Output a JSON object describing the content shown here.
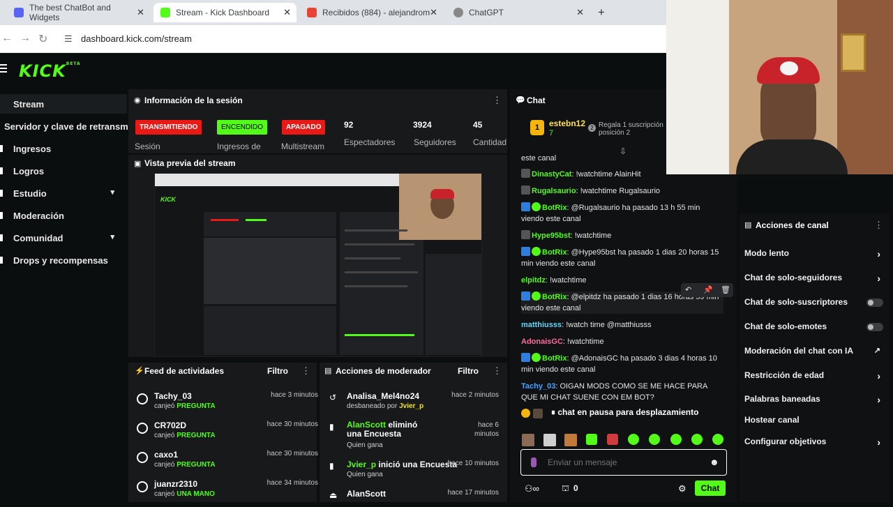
{
  "browser": {
    "tabs": [
      {
        "title": "The best ChatBot and Widgets",
        "color": "#5865f2"
      },
      {
        "title": "Stream - Kick Dashboard",
        "color": "#53fc18"
      },
      {
        "title": "Recibidos (884) - alejandromer",
        "color": "#ea4335"
      },
      {
        "title": "ChatGPT",
        "color": "#888888"
      }
    ],
    "new_tab": "+",
    "close": "✕",
    "url": "dashboard.kick.com/stream"
  },
  "app": {
    "logo": "KICK",
    "logo_tag": "BETA",
    "accent": "#53fc18"
  },
  "sidebar": {
    "items": [
      {
        "label": "Stream",
        "icon": "video-icon"
      },
      {
        "label": "Servidor y clave de retransm",
        "icon": ""
      },
      {
        "label": "Ingresos",
        "icon": "money-icon"
      },
      {
        "label": "Logros",
        "icon": "trophy-icon"
      },
      {
        "label": "Estudio",
        "icon": "studio-icon",
        "chevron": "▾"
      },
      {
        "label": "Moderación",
        "icon": "shield-icon"
      },
      {
        "label": "Comunidad",
        "icon": "people-icon",
        "chevron": "▾"
      },
      {
        "label": "Drops y recompensas",
        "icon": "gift-icon"
      }
    ]
  },
  "session": {
    "title": "Información de la sesión",
    "menu": "⋮",
    "badges": [
      {
        "label": "TRANSMITIENDO",
        "bg": "#e91916",
        "fg": "#ffffff"
      },
      {
        "label": "ENCENDIDO",
        "bg": "#53fc18",
        "fg": "#000000"
      },
      {
        "label": "APAGADO",
        "bg": "#e91916",
        "fg": "#ffffff"
      }
    ],
    "stats": [
      {
        "value": "92",
        "label": "Espectadores"
      },
      {
        "value": "3924",
        "label": "Seguidores"
      },
      {
        "value": "45",
        "label": "Cantidad"
      }
    ],
    "badge_labels": [
      "Sesión",
      "Ingresos de",
      "Multistream"
    ]
  },
  "preview": {
    "title": "Vista previa del stream"
  },
  "feed": {
    "title": "Feed de actividades",
    "filter": "Filtro",
    "menu": "⋮",
    "rows": [
      {
        "name": "Tachy_03",
        "action": "canjeó",
        "item": "PREGUNTA",
        "time": "hace 3 minutos"
      },
      {
        "name": "CR702D",
        "action": "canjeó",
        "item": "PREGUNTA",
        "time": "hace 30 minutos"
      },
      {
        "name": "caxo1",
        "action": "canjeó",
        "item": "PREGUNTA",
        "time": "hace 30 minutos"
      },
      {
        "name": "juanzr2310",
        "action": "canjeó",
        "item": "UNA MANO",
        "time": "hace 34 minutos"
      }
    ]
  },
  "modactions": {
    "title": "Acciones de moderador",
    "filter": "Filtro",
    "menu": "⋮",
    "rows": [
      {
        "user": "Analisa_Mel4no24",
        "text": "",
        "sub_a": "desbaneado por",
        "sub_b": "Jvier_p",
        "time": "hace 2 minutos",
        "icon": "↺"
      },
      {
        "user": "AlanScott",
        "text": " eliminó una Encuesta",
        "sub_a": "Quien gana",
        "sub_b": "",
        "time": "hace 6 minutos",
        "icon": "▮"
      },
      {
        "user": "Jvier_p",
        "text": " inició una Encuesta",
        "sub_a": "Quien gana",
        "sub_b": "",
        "time": "hace 10 minutos",
        "icon": "▮"
      },
      {
        "user": "AlanScott",
        "text": "",
        "sub_a": "",
        "sub_b": "",
        "time": "hace 17 minutos",
        "icon": "⏏"
      }
    ]
  },
  "chat": {
    "title": "Chat",
    "pinned_user": "estebn12",
    "pinned_meta": "7",
    "pinned_text_1": "Regala 1 suscripción",
    "pinned_text_2": "posición 2",
    "pinned_rank": "1",
    "pinned_rank2": "2",
    "messages": [
      {
        "user": "",
        "color": "#ffffff",
        "text": "este canal",
        "bot": false
      },
      {
        "user": "DinastyCat",
        "color": "#53fc18",
        "text": ": !watchtime AlainHit",
        "bot": false,
        "badge": true
      },
      {
        "user": "Rugalsaurio",
        "color": "#53fc18",
        "text": ": !watchtime Rugalsaurio",
        "bot": false,
        "badge": true
      },
      {
        "user": "BotRix",
        "color": "#53fc18",
        "text": ": @Rugalsaurio ha pasado 13 h 55 min viendo este canal",
        "bot": true
      },
      {
        "user": "Hype95bst",
        "color": "#53fc18",
        "text": ": !watchtime",
        "bot": false,
        "badge": true
      },
      {
        "user": "BotRix",
        "color": "#53fc18",
        "text": ": @Hype95bst ha pasado 1 dias 20 horas 15 min viendo este canal",
        "bot": true
      },
      {
        "user": "elpitdz",
        "color": "#53fc18",
        "text": ": !watchtime",
        "bot": false
      },
      {
        "user": "BotRix",
        "color": "#53fc18",
        "text": ": @elpitdz ha pasado 1 dias 16 horas 59 min viendo este canal",
        "bot": true
      },
      {
        "user": "matthiusss",
        "color": "#5fd7ff",
        "text": ": !watch time @matthiusss",
        "bot": false
      },
      {
        "user": "AdonaisGC",
        "color": "#ff6b9a",
        "text": ": !watchtime",
        "bot": false
      },
      {
        "user": "BotRix",
        "color": "#53fc18",
        "text": ": @AdonaisGC ha pasado 3 dias 4 horas 10 min viendo este canal",
        "bot": true
      },
      {
        "user": "Tachy_03",
        "color": "#4aa3ff",
        "text": ": OIGAN MODS COMO SE ME HACE PARA QUE MI CHAT SUENE CON EM BOT?",
        "bot": false
      }
    ],
    "paused": "chat en pausa para desplazamiento",
    "input_placeholder": "Enviar un mensaje",
    "count": "0",
    "send": "Chat"
  },
  "channel_actions": {
    "title": "Acciones de canal",
    "menu": "⋮",
    "items": [
      {
        "label": "Modo lento",
        "kind": "arrow"
      },
      {
        "label": "Chat de solo-seguidores",
        "kind": "arrow"
      },
      {
        "label": "Chat de solo-suscriptores",
        "kind": "toggle"
      },
      {
        "label": "Chat de solo-emotes",
        "kind": "toggle"
      },
      {
        "label": "Moderación del chat con IA",
        "kind": "external"
      },
      {
        "label": "Restricción de edad",
        "kind": "arrow"
      },
      {
        "label": "Palabras baneadas",
        "kind": "arrow"
      },
      {
        "label": "Hostear canal",
        "kind": "none"
      },
      {
        "label": "Configurar objetivos",
        "kind": "arrow"
      }
    ]
  }
}
